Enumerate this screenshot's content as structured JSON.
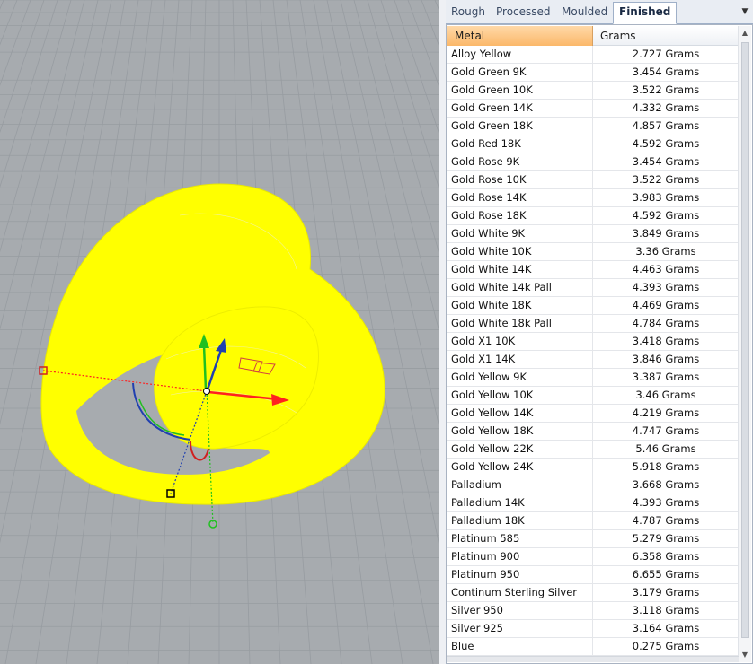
{
  "viewport": {
    "background_color": "#a7abaf",
    "grid_color": "#979ca1",
    "model_color": "#ffff00",
    "gizmo": {
      "x_axis_color": "#ff2020",
      "y_axis_color": "#20c020",
      "z_axis_color": "#2040b0",
      "icons": [
        "move-gizmo-icon",
        "rotate-arc-icon",
        "scale-handle-icon"
      ]
    }
  },
  "tabs": [
    {
      "label": "Rough",
      "active": false
    },
    {
      "label": "Processed",
      "active": false
    },
    {
      "label": "Moulded",
      "active": false
    },
    {
      "label": "Finished",
      "active": true
    }
  ],
  "tab_menu_icon": "dropdown-arrow-icon",
  "table": {
    "columns": [
      "Metal",
      "Grams"
    ],
    "sorted_column_color": "#fbb86a",
    "rows": [
      [
        "Alloy Yellow",
        "2.727 Grams"
      ],
      [
        "Gold Green 9K",
        "3.454 Grams"
      ],
      [
        "Gold Green 10K",
        "3.522 Grams"
      ],
      [
        "Gold Green 14K",
        "4.332 Grams"
      ],
      [
        "Gold Green 18K",
        "4.857 Grams"
      ],
      [
        "Gold Red 18K",
        "4.592 Grams"
      ],
      [
        "Gold Rose 9K",
        "3.454 Grams"
      ],
      [
        "Gold Rose 10K",
        "3.522 Grams"
      ],
      [
        "Gold Rose 14K",
        "3.983 Grams"
      ],
      [
        "Gold Rose 18K",
        "4.592 Grams"
      ],
      [
        "Gold White 9K",
        "3.849 Grams"
      ],
      [
        "Gold White 10K",
        "3.36 Grams"
      ],
      [
        "Gold White 14K",
        "4.463 Grams"
      ],
      [
        "Gold White 14k Pall",
        "4.393 Grams"
      ],
      [
        "Gold White 18K",
        "4.469 Grams"
      ],
      [
        "Gold White 18k Pall",
        "4.784 Grams"
      ],
      [
        "Gold X1 10K",
        "3.418 Grams"
      ],
      [
        "Gold X1 14K",
        "3.846 Grams"
      ],
      [
        "Gold Yellow 9K",
        "3.387 Grams"
      ],
      [
        "Gold Yellow 10K",
        "3.46 Grams"
      ],
      [
        "Gold Yellow 14K",
        "4.219 Grams"
      ],
      [
        "Gold Yellow 18K",
        "4.747 Grams"
      ],
      [
        "Gold Yellow 22K",
        "5.46 Grams"
      ],
      [
        "Gold Yellow 24K",
        "5.918 Grams"
      ],
      [
        "Palladium",
        "3.668 Grams"
      ],
      [
        "Palladium 14K",
        "4.393 Grams"
      ],
      [
        "Palladium 18K",
        "4.787 Grams"
      ],
      [
        "Platinum 585",
        "5.279 Grams"
      ],
      [
        "Platinum 900",
        "6.358 Grams"
      ],
      [
        "Platinum 950",
        "6.655 Grams"
      ],
      [
        "Continum Sterling Silver",
        "3.179 Grams"
      ],
      [
        "Silver 950",
        "3.118 Grams"
      ],
      [
        "Silver 925",
        "3.164 Grams"
      ],
      [
        "Blue",
        "0.275 Grams"
      ]
    ]
  }
}
